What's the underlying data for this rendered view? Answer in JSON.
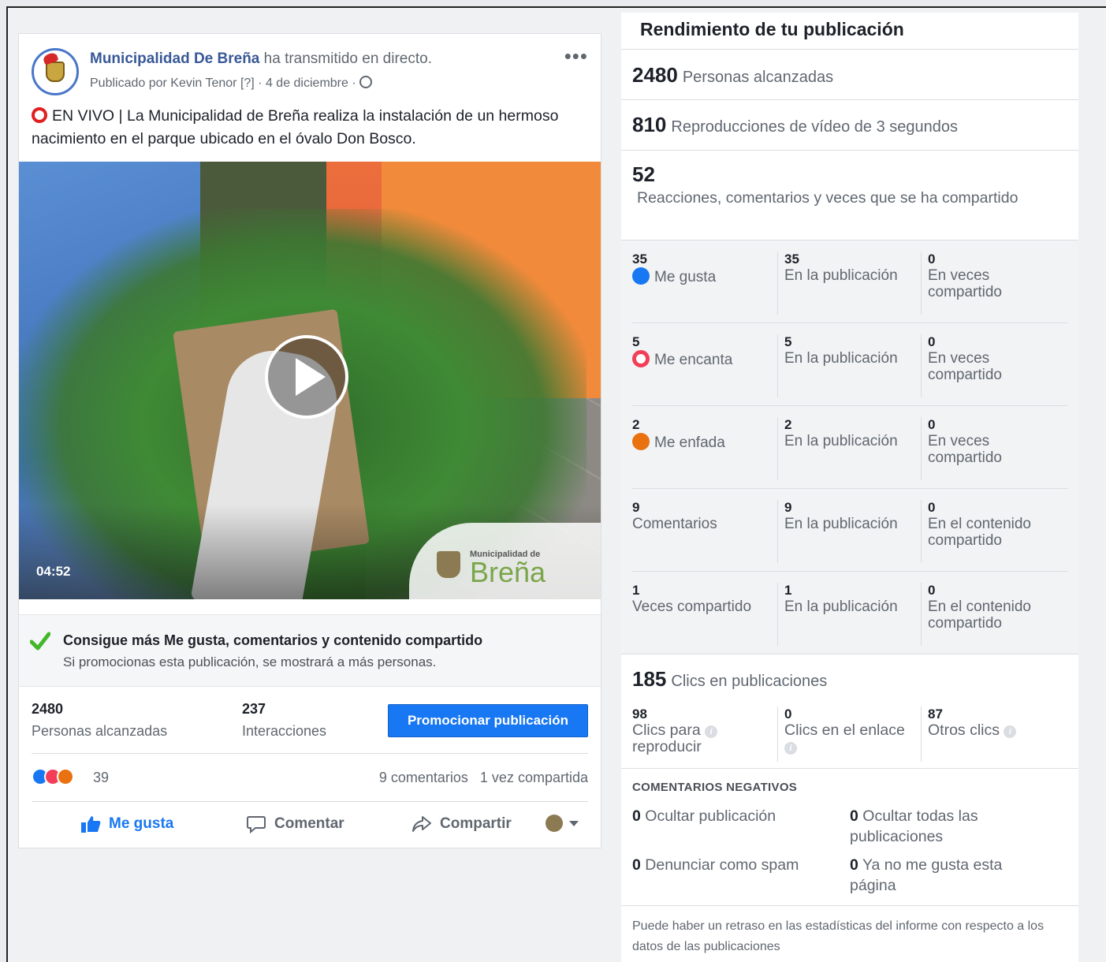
{
  "post": {
    "page_name": "Municipalidad De Breña",
    "action_text": "ha transmitido en directo.",
    "meta": "Publicado por Kevin Tenor [?] · 4 de diciembre ·",
    "more": "•••",
    "caption": "EN VIVO | La Municipalidad de Breña realiza la instalación de un hermoso nacimiento en el parque ubicado en el óvalo Don Bosco.",
    "video_duration": "04:52",
    "watermark_small": "Municipalidad de",
    "watermark_big": "Breña",
    "promo_title": "Consigue más Me gusta, comentarios y contenido compartido",
    "promo_sub": "Si promocionas esta publicación, se mostrará a más personas.",
    "reach_num": "2480",
    "reach_label": "Personas alcanzadas",
    "interactions_num": "237",
    "interactions_label": "Interacciones",
    "promote_button": "Promocionar publicación",
    "reaction_count": "39",
    "comments_count": "9 comentarios",
    "shares_count": "1 vez compartida",
    "like_action": "Me gusta",
    "comment_action": "Comentar",
    "share_action": "Compartir"
  },
  "panel": {
    "title": "Rendimiento de tu publicación",
    "reach_num": "2480",
    "reach_label": "Personas alcanzadas",
    "views_num": "810",
    "views_label": "Reproducciones de vídeo de 3 segundos",
    "engage_num": "52",
    "engage_label": "Reacciones, comentarios y veces que se ha compartido",
    "rows": [
      {
        "n1": "35",
        "l1": "Me gusta",
        "n2": "35",
        "l2": "En la publicación",
        "n3": "0",
        "l3a": "En veces",
        "l3b": "compartido"
      },
      {
        "n1": "5",
        "l1": "Me encanta",
        "n2": "5",
        "l2": "En la publicación",
        "n3": "0",
        "l3a": "En veces",
        "l3b": "compartido"
      },
      {
        "n1": "2",
        "l1": "Me enfada",
        "n2": "2",
        "l2": "En la publicación",
        "n3": "0",
        "l3a": "En veces",
        "l3b": "compartido"
      },
      {
        "n1": "9",
        "l1": "Comentarios",
        "n2": "9",
        "l2": "En la publicación",
        "n3": "0",
        "l3a": "En el contenido",
        "l3b": "compartido"
      },
      {
        "n1": "1",
        "l1": "Veces compartido",
        "n2": "1",
        "l2": "En la publicación",
        "n3": "0",
        "l3a": "En el contenido",
        "l3b": "compartido"
      }
    ],
    "clicks_num": "185",
    "clicks_label": "Clics en publicaciones",
    "click_play_num": "98",
    "click_play_l1": "Clics para",
    "click_play_l2": "reproducir",
    "click_link_num": "0",
    "click_link_label": "Clics en el enlace",
    "click_other_num": "87",
    "click_other_label": "Otros clics",
    "neg_title": "COMENTARIOS NEGATIVOS",
    "neg_hide_num": "0",
    "neg_hide_label": "Ocultar publicación",
    "neg_hide_all_num": "0",
    "neg_hide_all_label": "Ocultar todas las publicaciones",
    "neg_spam_num": "0",
    "neg_spam_label": "Denunciar como spam",
    "neg_unlike_num": "0",
    "neg_unlike_label": "Ya no me gusta esta página",
    "footnote": "Puede haber un retraso en las estadísticas del informe con respecto a los datos de las publicaciones",
    "info_glyph": "i"
  },
  "colors": {
    "accent": "#1877f2",
    "link": "#385898",
    "love": "#f33e58",
    "angry": "#e9710f"
  }
}
